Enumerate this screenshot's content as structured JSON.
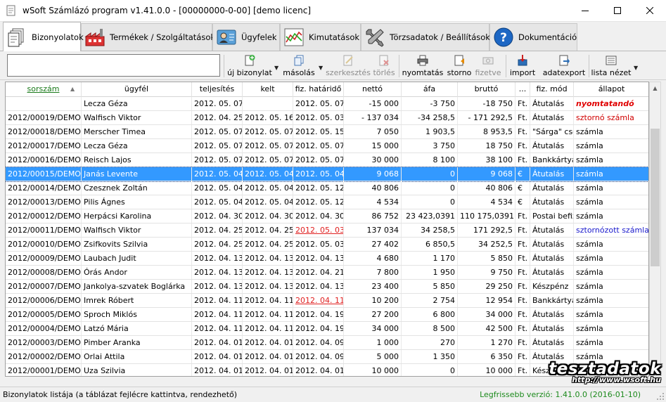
{
  "window": {
    "title": "wSoft Számlázó program v1.41.0.0 - [00000000-0-00] [demo licenc]",
    "icons": {
      "app": "document-icon",
      "minimize": "minimize-icon",
      "maximize": "maximize-icon",
      "close": "close-icon"
    }
  },
  "tabs": [
    {
      "label": "Bizonyolatok",
      "icon": "documents-stack-icon",
      "active": true
    },
    {
      "label": "Termékek / Szolgáltatások",
      "icon": "factory-icon",
      "active": false
    },
    {
      "label": "Ügyfelek",
      "icon": "contact-card-icon",
      "active": false
    },
    {
      "label": "Kimutatások",
      "icon": "line-chart-icon",
      "active": false
    },
    {
      "label": "Törzsadatok / Beállítások",
      "icon": "tools-icon",
      "active": false
    },
    {
      "label": "Dokumentáció",
      "icon": "help-icon",
      "active": false
    }
  ],
  "toolbar": {
    "search_value": "",
    "buttons": [
      {
        "label": "új bizonylat",
        "icon": "new-document-icon",
        "enabled": true,
        "dropdown": true
      },
      {
        "label": "másolás",
        "icon": "copy-icon",
        "enabled": true,
        "dropdown": true
      },
      {
        "label": "szerkesztés",
        "icon": "edit-icon",
        "enabled": false,
        "dropdown": false
      },
      {
        "label": "törlés",
        "icon": "delete-icon",
        "enabled": false,
        "dropdown": false
      },
      {
        "label": "nyomtatás",
        "icon": "printer-icon",
        "enabled": true,
        "dropdown": false
      },
      {
        "label": "storno",
        "icon": "storno-icon",
        "enabled": true,
        "dropdown": false
      },
      {
        "label": "fizetve",
        "icon": "cash-icon",
        "enabled": false,
        "dropdown": false
      },
      {
        "label": "import",
        "icon": "import-icon",
        "enabled": true,
        "dropdown": false
      },
      {
        "label": "adatexport",
        "icon": "export-icon",
        "enabled": true,
        "dropdown": false
      },
      {
        "label": "lista nézet",
        "icon": "list-view-icon",
        "enabled": true,
        "dropdown": true
      }
    ]
  },
  "table": {
    "columns": [
      "sorszám",
      "ügyfél",
      "teljesítés",
      "kelt",
      "fiz. határidő",
      "nettó",
      "áfa",
      "bruttó",
      "...",
      "fiz. mód",
      "állapot"
    ],
    "sorted_column": "sorszám",
    "sort_direction": "ascending",
    "rows": [
      {
        "sorszam": "",
        "ugyfel": "Lecza Géza",
        "teljesites": "2012. 05. 07.",
        "kelt": "",
        "hatarido": "2012. 05. 07.",
        "netto": "-15 000",
        "afa": "-3 750",
        "brutto": "-18 750",
        "penznem": "Ft.",
        "fizmod": "Átutalás",
        "allapot": "nyomtatandó",
        "allapot_style": "redbold",
        "hatarido_overdue": false,
        "selected": false
      },
      {
        "sorszam": "2012/00019/DEMO",
        "ugyfel": "Walfisch Viktor",
        "teljesites": "2012. 04. 25.",
        "kelt": "2012. 05. 16.",
        "hatarido": "2012. 05. 03.",
        "netto": "- 137 034",
        "afa": "-34 258,5",
        "brutto": "- 171 292,5",
        "penznem": "Ft.",
        "fizmod": "Átutalás",
        "allapot": "sztornó számla",
        "allapot_style": "red",
        "hatarido_overdue": false,
        "selected": false
      },
      {
        "sorszam": "2012/00018/DEMO",
        "ugyfel": "Merscher Timea",
        "teljesites": "2012. 05. 07.",
        "kelt": "2012. 05. 07.",
        "hatarido": "2012. 05. 15.",
        "netto": "7 050",
        "afa": "1 903,5",
        "brutto": "8 953,5",
        "penznem": "Ft.",
        "fizmod": "\"Sárga\" csekk",
        "allapot": "számla",
        "allapot_style": "normal",
        "hatarido_overdue": false,
        "selected": false
      },
      {
        "sorszam": "2012/00017/DEMO",
        "ugyfel": "Lecza Géza",
        "teljesites": "2012. 05. 07.",
        "kelt": "2012. 05. 07.",
        "hatarido": "2012. 05. 07.",
        "netto": "15 000",
        "afa": "3 750",
        "brutto": "18 750",
        "penznem": "Ft.",
        "fizmod": "Átutalás",
        "allapot": "számla",
        "allapot_style": "normal",
        "hatarido_overdue": false,
        "selected": false
      },
      {
        "sorszam": "2012/00016/DEMO",
        "ugyfel": "Reisch Lajos",
        "teljesites": "2012. 05. 07.",
        "kelt": "2012. 05. 07.",
        "hatarido": "2012. 05. 07.",
        "netto": "30 000",
        "afa": "8 100",
        "brutto": "38 100",
        "penznem": "Ft.",
        "fizmod": "Bankkártya",
        "allapot": "számla",
        "allapot_style": "normal",
        "hatarido_overdue": false,
        "selected": false
      },
      {
        "sorszam": "2012/00015/DEMO",
        "ugyfel": "Janás Levente",
        "teljesites": "2012. 05. 04.",
        "kelt": "2012. 05. 04.",
        "hatarido": "2012. 05. 04.",
        "netto": "9 068",
        "afa": "0",
        "brutto": "9 068",
        "penznem": "€",
        "fizmod": "Átutalás",
        "allapot": "számla",
        "allapot_style": "normal",
        "hatarido_overdue": false,
        "selected": true
      },
      {
        "sorszam": "2012/00014/DEMO",
        "ugyfel": "Czesznek Zoltán",
        "teljesites": "2012. 05. 04.",
        "kelt": "2012. 05. 04.",
        "hatarido": "2012. 05. 12.",
        "netto": "40 806",
        "afa": "0",
        "brutto": "40 806",
        "penznem": "€",
        "fizmod": "Átutalás",
        "allapot": "számla",
        "allapot_style": "normal",
        "hatarido_overdue": false,
        "selected": false
      },
      {
        "sorszam": "2012/00013/DEMO",
        "ugyfel": "Pilis Ágnes",
        "teljesites": "2012. 05. 04.",
        "kelt": "2012. 05. 04.",
        "hatarido": "2012. 05. 12.",
        "netto": "4 534",
        "afa": "0",
        "brutto": "4 534",
        "penznem": "€",
        "fizmod": "Átutalás",
        "allapot": "számla",
        "allapot_style": "normal",
        "hatarido_overdue": false,
        "selected": false
      },
      {
        "sorszam": "2012/00012/DEMO",
        "ugyfel": "Herpácsi Karolina",
        "teljesites": "2012. 04. 30.",
        "kelt": "2012. 04. 30.",
        "hatarido": "2012. 04. 30.",
        "netto": "86 752",
        "afa": "23 423,0391",
        "brutto": "110 175,0391",
        "penznem": "Ft.",
        "fizmod": "Postai befizetés",
        "allapot": "számla",
        "allapot_style": "normal",
        "hatarido_overdue": false,
        "selected": false
      },
      {
        "sorszam": "2012/00011/DEMO",
        "ugyfel": "Walfisch Viktor",
        "teljesites": "2012. 04. 25.",
        "kelt": "2012. 04. 25.",
        "hatarido": "2012. 05. 03.",
        "netto": "137 034",
        "afa": "34 258,5",
        "brutto": "171 292,5",
        "penznem": "Ft.",
        "fizmod": "Átutalás",
        "allapot": "sztornózott számla",
        "allapot_style": "blue",
        "hatarido_overdue": true,
        "selected": false
      },
      {
        "sorszam": "2012/00010/DEMO",
        "ugyfel": "Zsifkovits Szilvia",
        "teljesites": "2012. 04. 25.",
        "kelt": "2012. 04. 25.",
        "hatarido": "2012. 05. 03.",
        "netto": "27 402",
        "afa": "6 850,5",
        "brutto": "34 252,5",
        "penznem": "Ft.",
        "fizmod": "Átutalás",
        "allapot": "számla",
        "allapot_style": "normal",
        "hatarido_overdue": false,
        "selected": false
      },
      {
        "sorszam": "2012/00009/DEMO",
        "ugyfel": "Laubach Judit",
        "teljesites": "2012. 04. 13.",
        "kelt": "2012. 04. 13.",
        "hatarido": "2012. 04. 13.",
        "netto": "4 680",
        "afa": "1 170",
        "brutto": "5 850",
        "penznem": "Ft.",
        "fizmod": "Átutalás",
        "allapot": "számla",
        "allapot_style": "normal",
        "hatarido_overdue": false,
        "selected": false
      },
      {
        "sorszam": "2012/00008/DEMO",
        "ugyfel": "Órás Andor",
        "teljesites": "2012. 04. 13.",
        "kelt": "2012. 04. 13.",
        "hatarido": "2012. 04. 21.",
        "netto": "7 800",
        "afa": "1 950",
        "brutto": "9 750",
        "penznem": "Ft.",
        "fizmod": "Átutalás",
        "allapot": "számla",
        "allapot_style": "normal",
        "hatarido_overdue": false,
        "selected": false
      },
      {
        "sorszam": "2012/00007/DEMO",
        "ugyfel": "Jankolya-szvatek Boglárka",
        "teljesites": "2012. 04. 13.",
        "kelt": "2012. 04. 13.",
        "hatarido": "2012. 04. 13.",
        "netto": "23 400",
        "afa": "5 850",
        "brutto": "29 250",
        "penznem": "Ft.",
        "fizmod": "Készpénz",
        "allapot": "számla",
        "allapot_style": "normal",
        "hatarido_overdue": false,
        "selected": false
      },
      {
        "sorszam": "2012/00006/DEMO",
        "ugyfel": "Imrek Róbert",
        "teljesites": "2012. 04. 11.",
        "kelt": "2012. 04. 11.",
        "hatarido": "2012. 04. 11.",
        "netto": "10 200",
        "afa": "2 754",
        "brutto": "12 954",
        "penznem": "Ft.",
        "fizmod": "Bankkártya",
        "allapot": "számla",
        "allapot_style": "normal",
        "hatarido_overdue": true,
        "selected": false
      },
      {
        "sorszam": "2012/00005/DEMO",
        "ugyfel": "Sproch Miklós",
        "teljesites": "2012. 04. 11.",
        "kelt": "2012. 04. 11.",
        "hatarido": "2012. 04. 19.",
        "netto": "27 200",
        "afa": "6 800",
        "brutto": "34 000",
        "penznem": "Ft.",
        "fizmod": "Átutalás",
        "allapot": "számla",
        "allapot_style": "normal",
        "hatarido_overdue": false,
        "selected": false
      },
      {
        "sorszam": "2012/00004/DEMO",
        "ugyfel": "Latzó Mária",
        "teljesites": "2012. 04. 11.",
        "kelt": "2012. 04. 11.",
        "hatarido": "2012. 04. 19.",
        "netto": "34 000",
        "afa": "8 500",
        "brutto": "42 500",
        "penznem": "Ft.",
        "fizmod": "Átutalás",
        "allapot": "számla",
        "allapot_style": "normal",
        "hatarido_overdue": false,
        "selected": false
      },
      {
        "sorszam": "2012/00003/DEMO",
        "ugyfel": "Pimber Aranka",
        "teljesites": "2012. 04. 01.",
        "kelt": "2012. 04. 01.",
        "hatarido": "2012. 04. 09.",
        "netto": "1 000",
        "afa": "270",
        "brutto": "1 270",
        "penznem": "Ft.",
        "fizmod": "Átutalás",
        "allapot": "számla",
        "allapot_style": "normal",
        "hatarido_overdue": false,
        "selected": false
      },
      {
        "sorszam": "2012/00002/DEMO",
        "ugyfel": "Orlai Attila",
        "teljesites": "2012. 04. 01.",
        "kelt": "2012. 04. 01.",
        "hatarido": "2012. 04. 09.",
        "netto": "5 000",
        "afa": "1 350",
        "brutto": "6 350",
        "penznem": "Ft.",
        "fizmod": "Átutalás",
        "allapot": "számla",
        "allapot_style": "normal",
        "hatarido_overdue": false,
        "selected": false
      },
      {
        "sorszam": "2012/00001/DEMO",
        "ugyfel": "Uza Szilvia",
        "teljesites": "2012. 04. 01.",
        "kelt": "2012. 04. 01.",
        "hatarido": "2012. 04. 01.",
        "netto": "10 000",
        "afa": "0",
        "brutto": "10 000",
        "penznem": "Ft.",
        "fizmod": "Készpénz",
        "allapot": "",
        "allapot_style": "normal",
        "hatarido_overdue": false,
        "selected": false
      }
    ]
  },
  "watermark": {
    "text": "tesztadatok",
    "url": "http://www.wsoft.hu"
  },
  "status": {
    "left": "Bizonylatok listája (a táblázat fejlécre kattintva, rendezhető)",
    "right": "Legfrissebb verzió: 1.41.0.0 (2016-01-10)"
  },
  "colors": {
    "selection": "#3399ff",
    "overdue": "#e02020",
    "storno": "#d00000",
    "stornozott": "#1a1acc",
    "sorted_header": "#1a7a1a",
    "version_text": "#1c8a1c"
  }
}
